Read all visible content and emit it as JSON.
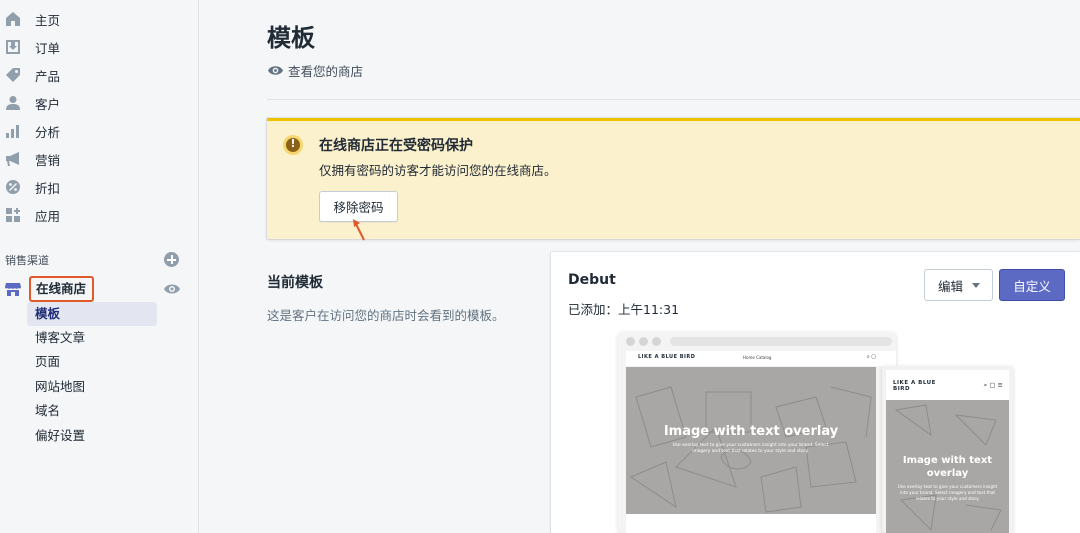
{
  "sidebar": {
    "items": [
      {
        "label": "主页",
        "icon": "home-icon"
      },
      {
        "label": "订单",
        "icon": "orders-icon"
      },
      {
        "label": "产品",
        "icon": "tag-icon"
      },
      {
        "label": "客户",
        "icon": "person-icon"
      },
      {
        "label": "分析",
        "icon": "bar-chart-icon"
      },
      {
        "label": "营销",
        "icon": "megaphone-icon"
      },
      {
        "label": "折扣",
        "icon": "discount-icon"
      },
      {
        "label": "应用",
        "icon": "apps-icon"
      }
    ],
    "sales_channels_label": "销售渠道",
    "online_store": {
      "label": "在线商店",
      "sub_items": [
        "模板",
        "博客文章",
        "页面",
        "网站地图",
        "域名",
        "偏好设置"
      ],
      "active_sub_item": "模板"
    }
  },
  "main": {
    "title": "模板",
    "view_store_link": "查看您的商店",
    "password_banner": {
      "title": "在线商店正在受密码保护",
      "text": "仅拥有密码的访客才能访问您的在线商店。",
      "button": "移除密码"
    },
    "current_theme": {
      "heading": "当前模板",
      "description": "这是客户在访问您的商店时会看到的模板。",
      "name": "Debut",
      "added": "已添加：上午11:31",
      "edit_button": "编辑",
      "customize_button": "自定义"
    },
    "preview": {
      "brand": "LIKE A BLUE BIRD",
      "nav": "Home   Catalog",
      "hero_title": "Image with text overlay",
      "hero_sub": "Use overlay text to give your customers insight into your brand. Select imagery and text that relates to your style and story.",
      "mobile_brand_line1": "LIKE A BLUE",
      "mobile_brand_line2": "BIRD",
      "mobile_hero_title_line1": "Image with text",
      "mobile_hero_title_line2": "overlay",
      "mobile_hero_sub": "Use overlay text to give your customers insight into your brand. Select imagery and text that relates to your style and story."
    }
  },
  "colors": {
    "accent": "#5c6ac4",
    "banner_bg": "#fcf1cd",
    "banner_border": "#eec200",
    "annotation": "#e0592b"
  }
}
